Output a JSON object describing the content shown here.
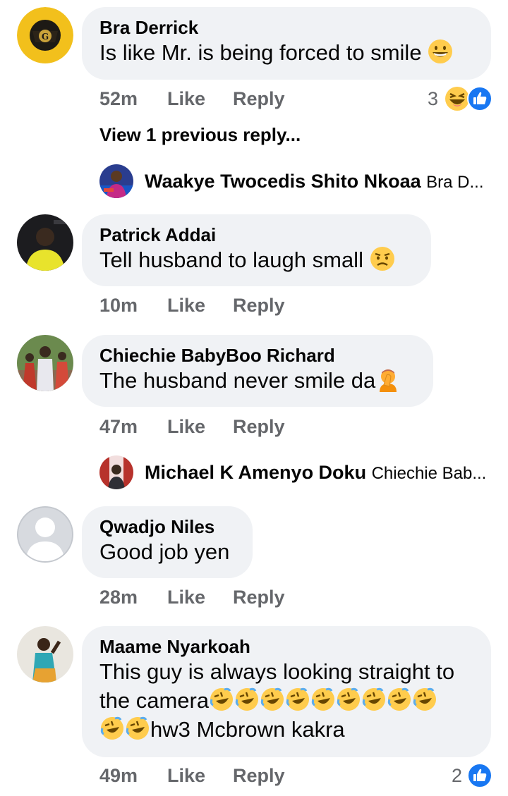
{
  "comments": [
    {
      "name": "Bra Derrick",
      "text": "Is like Mr. is being forced to smile",
      "time": "52m",
      "like": "Like",
      "reply": "Reply",
      "reaction_count": "3"
    },
    {
      "name": "Patrick Addai",
      "text": "Tell husband to laugh small",
      "time": "10m",
      "like": "Like",
      "reply": "Reply"
    },
    {
      "name": "Chiechie BabyBoo Richard",
      "text": "The husband never smile da",
      "time": "47m",
      "like": "Like",
      "reply": "Reply"
    },
    {
      "name": "Qwadjo Niles",
      "text": "Good job yen",
      "time": "28m",
      "like": "Like",
      "reply": "Reply"
    },
    {
      "name": "Maame Nyarkoah",
      "text_line1": "This guy is always looking straight to",
      "text_line2": "the camera",
      "text_line3": "hw3 Mcbrown kakra",
      "time": "49m",
      "like": "Like",
      "reply": "Reply",
      "reaction_count": "2"
    }
  ],
  "view_previous": "View 1 previous reply...",
  "replies": [
    {
      "name": "Waakye Twocedis Shito Nkoaa",
      "preview": "Bra D..."
    },
    {
      "name": "Michael K Amenyo Doku",
      "preview": "Chiechie Bab..."
    }
  ],
  "colors": {
    "bubble": "#f0f2f5",
    "meta": "#65676b",
    "like_blue": "#1877f2",
    "emoji_yellow": "#ffcc4d"
  },
  "icons": [
    "grinning-face-icon",
    "laughing-face-icon",
    "like-reaction-icon",
    "frowning-face-icon",
    "facepalm-icon",
    "rofl-face-icon"
  ]
}
